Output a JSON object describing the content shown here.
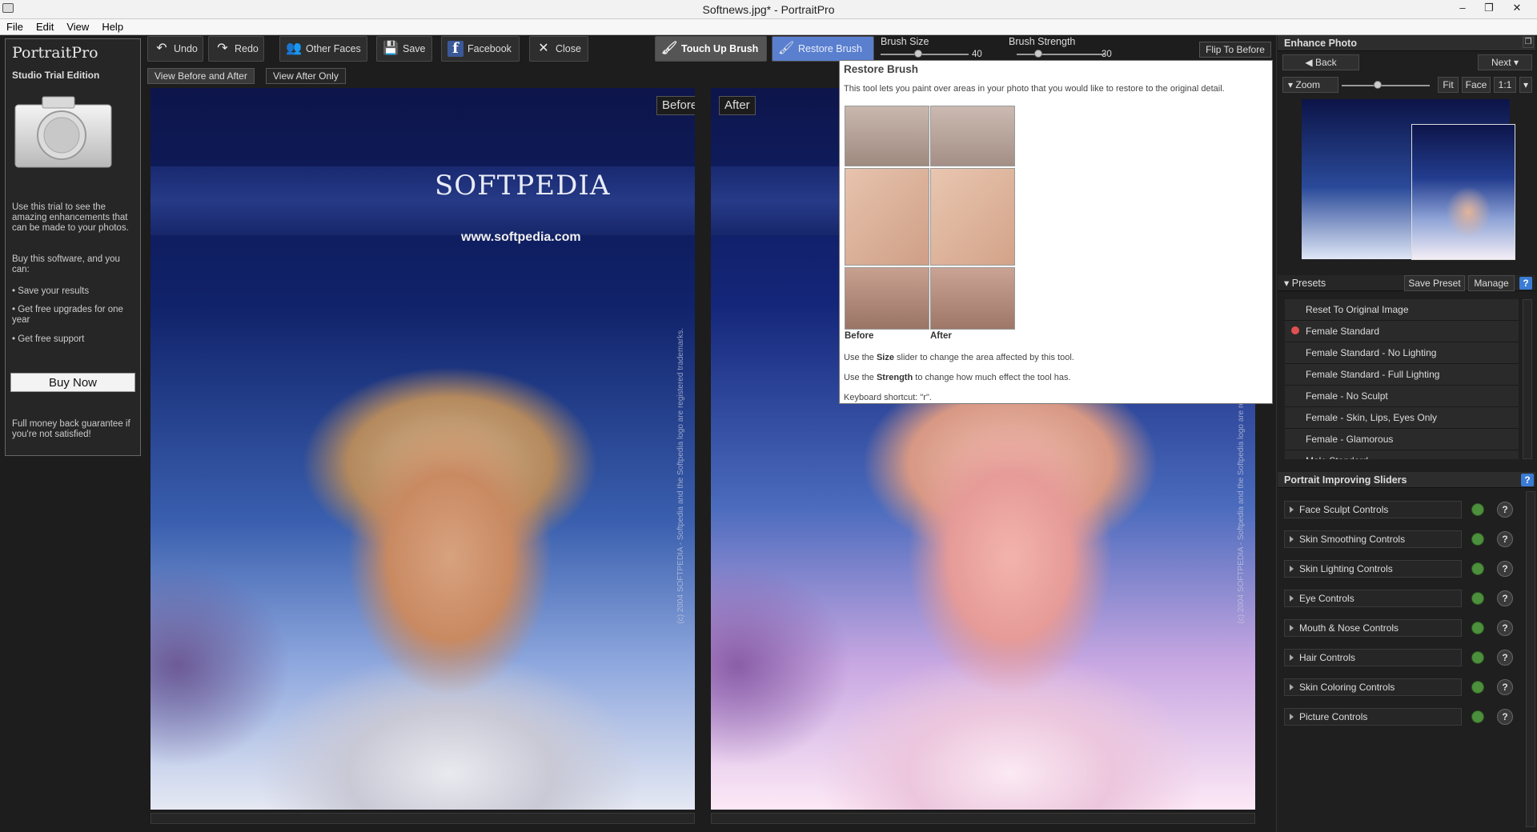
{
  "window": {
    "title": "Softnews.jpg* - PortraitPro",
    "minimize": "–",
    "restore": "❐",
    "close": "✕"
  },
  "menu": [
    "File",
    "Edit",
    "View",
    "Help"
  ],
  "left_panel": {
    "title": "PortraitPro",
    "edition": "Studio Trial Edition",
    "intro": "Use this trial to see the amazing enhancements that can be made to your photos.",
    "buy_intro": "Buy this software, and you can:",
    "benefits": [
      "Save your results",
      "Get free upgrades for one year",
      "Get free support"
    ],
    "buy_button": "Buy Now",
    "guarantee": "Full money back guarantee if you're not satisfied!"
  },
  "toolbar": {
    "undo": "Undo",
    "redo": "Redo",
    "other_faces": "Other Faces",
    "save": "Save",
    "facebook": "Facebook",
    "close": "Close",
    "touch_up_brush": "Touch Up Brush",
    "restore_brush": "Restore Brush",
    "brush_size_label": "Brush Size",
    "brush_size_value": "40",
    "brush_strength_label": "Brush Strength",
    "brush_strength_value": "30",
    "flip": "Flip To Before"
  },
  "view_tabs": [
    "View Before and After",
    "View After Only"
  ],
  "panes": {
    "before_label": "Before",
    "after_label": "After",
    "brand": "SOFTPEDIA",
    "url": "www.softpedia.com",
    "side_text": "(c) 2004 SOFTPEDIA - Softpedia and the Softpedia logo are registered trademarks."
  },
  "tooltip": {
    "title": "Restore Brush",
    "desc": "This tool lets you paint over areas in your photo that you would like to restore to the original detail.",
    "before": "Before",
    "after": "After",
    "size_pre": "Use the ",
    "size_bold": "Size",
    "size_post": " slider to change the area affected by this tool.",
    "strength_pre": "Use the ",
    "strength_bold": "Strength",
    "strength_post": " to change how much effect the tool has.",
    "shortcut": "Keyboard shortcut: \"r\"."
  },
  "right_panel": {
    "enhance_title": "Enhance Photo",
    "back": "Back",
    "next": "Next",
    "zoom": "Zoom",
    "fit": "Fit",
    "face": "Face",
    "one_to_one": "1:1",
    "presets_title": "Presets",
    "save_preset": "Save Preset",
    "manage": "Manage",
    "presets": [
      "Reset To Original Image",
      "Female Standard",
      "Female Standard - No Lighting",
      "Female Standard - Full Lighting",
      "Female - No Sculpt",
      "Female - Skin, Lips, Eyes Only",
      "Female - Glamorous",
      "Male Standard"
    ],
    "sliders_title": "Portrait Improving Sliders",
    "sliders": [
      "Face Sculpt Controls",
      "Skin Smoothing Controls",
      "Skin Lighting Controls",
      "Eye Controls",
      "Mouth & Nose Controls",
      "Hair Controls",
      "Skin Coloring Controls",
      "Picture Controls"
    ],
    "help": "?"
  },
  "colors": {
    "accent": "#5a7fcf",
    "toggle_on": "#4c8f3c",
    "facebook": "#3b5998"
  }
}
